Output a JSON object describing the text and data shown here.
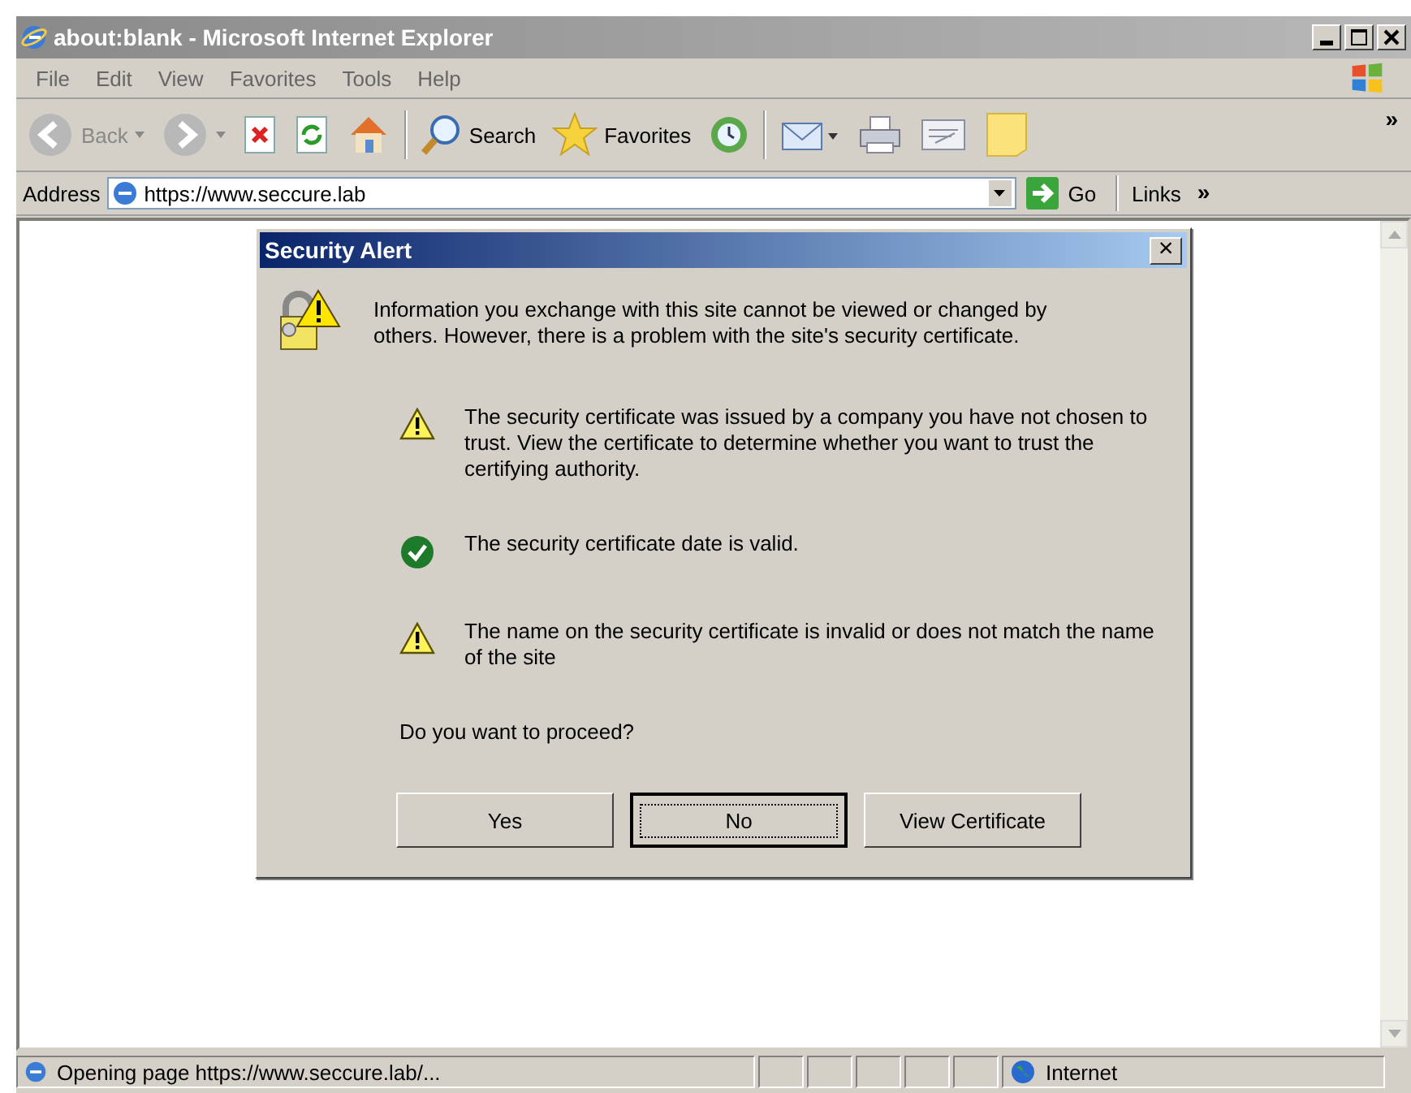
{
  "window": {
    "title": "about:blank - Microsoft Internet Explorer"
  },
  "menu": [
    "File",
    "Edit",
    "View",
    "Favorites",
    "Tools",
    "Help"
  ],
  "toolbar": [
    {
      "kind": "back",
      "label": "Back",
      "disabled": true
    },
    {
      "kind": "forward",
      "disabled": true
    },
    {
      "kind": "stop"
    },
    {
      "kind": "refresh"
    },
    {
      "kind": "home"
    },
    {
      "kind": "search",
      "label": "Search"
    },
    {
      "kind": "favorites",
      "label": "Favorites"
    },
    {
      "kind": "history"
    },
    {
      "kind": "mail"
    },
    {
      "kind": "print"
    },
    {
      "kind": "edit"
    },
    {
      "kind": "note"
    }
  ],
  "toolbar_more": "»",
  "address": {
    "label": "Address",
    "value": "https://www.seccure.lab",
    "go": "Go",
    "links": "Links",
    "links_more": "»"
  },
  "dialog": {
    "title": "Security Alert",
    "close": "×",
    "intro": "Information you exchange with this site cannot be viewed or changed by others. However, there is a problem with the site's security certificate.",
    "items": [
      {
        "kind": "warning",
        "text": "The security certificate was issued by a company you have not chosen to trust. View the certificate to determine whether you want to trust the certifying authority."
      },
      {
        "kind": "ok",
        "text": "The security certificate date is valid."
      },
      {
        "kind": "warning",
        "text": "The name on the security certificate is invalid or does not match the name of the site"
      }
    ],
    "question": "Do you want to proceed?",
    "buttons": [
      {
        "label": "Yes",
        "default": false
      },
      {
        "label": "No",
        "default": true
      },
      {
        "label": "View Certificate",
        "default": false
      }
    ]
  },
  "status_bar": {
    "text": "Opening page https://www.seccure.lab/...",
    "zone": "Internet"
  }
}
